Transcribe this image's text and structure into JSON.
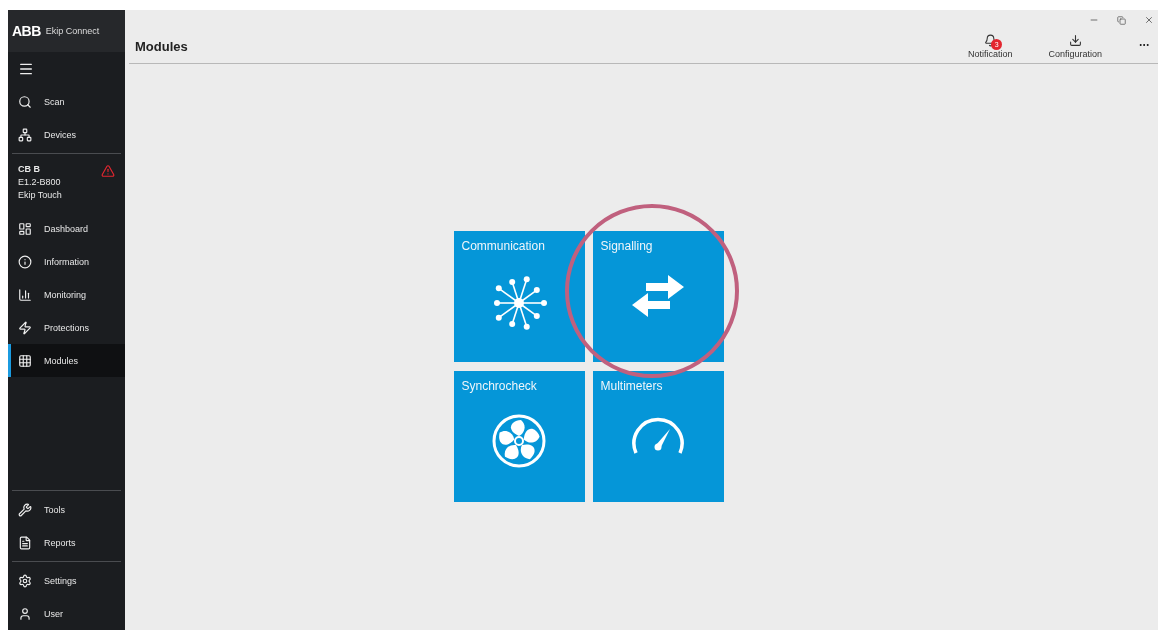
{
  "app": {
    "brand": "ABB",
    "name": "Ekip Connect"
  },
  "nav_top": [
    {
      "kind": "scan",
      "label": "Scan",
      "selected": false
    },
    {
      "kind": "devices",
      "label": "Devices",
      "selected": false
    }
  ],
  "device": {
    "lines": [
      "CB B",
      "E1.2-B800",
      "Ekip Touch"
    ],
    "warning": true
  },
  "nav_main": [
    {
      "kind": "dashboard",
      "label": "Dashboard",
      "selected": false
    },
    {
      "kind": "information",
      "label": "Information",
      "selected": false
    },
    {
      "kind": "monitoring",
      "label": "Monitoring",
      "selected": false
    },
    {
      "kind": "protections",
      "label": "Protections",
      "selected": false
    },
    {
      "kind": "modules",
      "label": "Modules",
      "selected": true
    }
  ],
  "nav_tools": [
    {
      "kind": "tools",
      "label": "Tools",
      "selected": false
    },
    {
      "kind": "reports",
      "label": "Reports",
      "selected": false
    }
  ],
  "nav_bottom": [
    {
      "kind": "settings",
      "label": "Settings",
      "selected": false
    },
    {
      "kind": "user",
      "label": "User",
      "selected": false
    }
  ],
  "page_title": "Modules",
  "toolbar": [
    {
      "kind": "notification",
      "label": "Notification",
      "badge": "3"
    },
    {
      "kind": "configuration",
      "label": "Configuration"
    }
  ],
  "tiles": [
    {
      "kind": "communication",
      "label": "Communication",
      "highlighted": false
    },
    {
      "kind": "signalling",
      "label": "Signalling",
      "highlighted": true
    },
    {
      "kind": "synchrocheck",
      "label": "Synchrocheck",
      "highlighted": false
    },
    {
      "kind": "multimeters",
      "label": "Multimeters",
      "highlighted": false
    }
  ]
}
